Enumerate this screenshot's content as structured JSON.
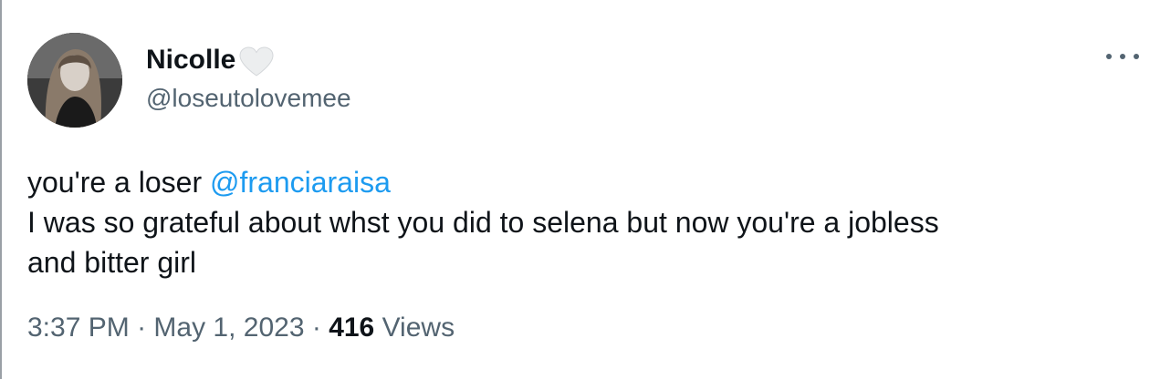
{
  "user": {
    "display_name": "Nicolle",
    "handle": "@loseutolovemee",
    "name_emoji": "white-heart-icon"
  },
  "tweet": {
    "line1_prefix": "you're a loser ",
    "mention": "@franciaraisa",
    "line2": "I was so grateful about whst you did to selena but now you're a jobless",
    "line3": "and bitter girl"
  },
  "meta": {
    "time": "3:37 PM",
    "separator": " · ",
    "date": "May 1, 2023",
    "views_count": "416",
    "views_label": " Views"
  },
  "icons": {
    "more": "more-horizontal-icon",
    "heart": "white-heart-icon"
  },
  "colors": {
    "text": "#0f1419",
    "secondary": "#536471",
    "link": "#1d9bf0"
  }
}
